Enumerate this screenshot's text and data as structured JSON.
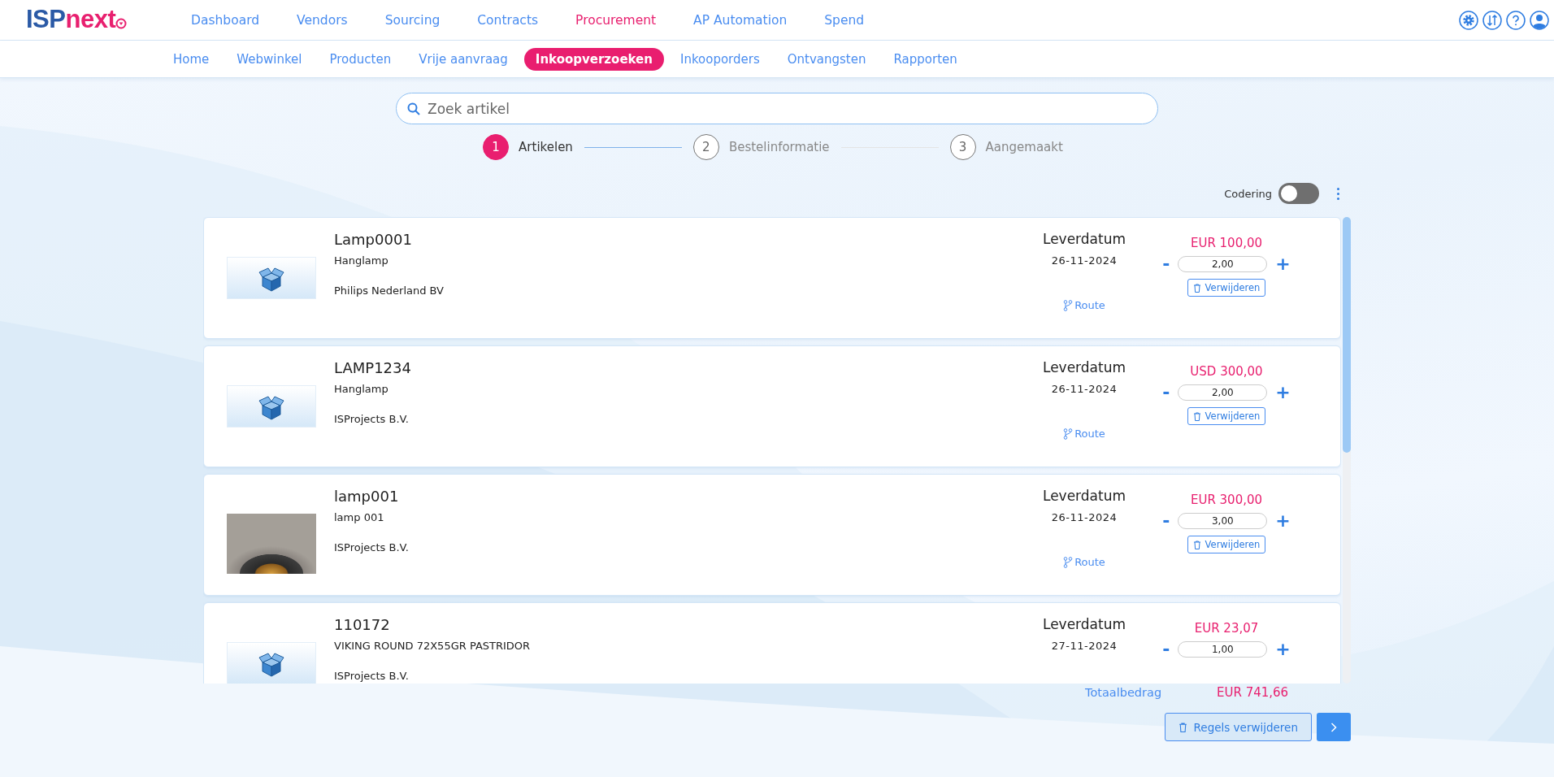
{
  "logo": {
    "text_1": "ISP",
    "text_2": "next"
  },
  "main_nav": [
    {
      "label": "Dashboard",
      "selected": false
    },
    {
      "label": "Vendors",
      "selected": false
    },
    {
      "label": "Sourcing",
      "selected": false
    },
    {
      "label": "Contracts",
      "selected": false
    },
    {
      "label": "Procurement",
      "selected": true
    },
    {
      "label": "AP Automation",
      "selected": false
    },
    {
      "label": "Spend",
      "selected": false
    }
  ],
  "sub_nav": [
    {
      "label": "Home",
      "selected": false
    },
    {
      "label": "Webwinkel",
      "selected": false
    },
    {
      "label": "Producten",
      "selected": false
    },
    {
      "label": "Vrije aanvraag",
      "selected": false
    },
    {
      "label": "Inkoopverzoeken",
      "selected": true
    },
    {
      "label": "Inkooporders",
      "selected": false
    },
    {
      "label": "Ontvangsten",
      "selected": false
    },
    {
      "label": "Rapporten",
      "selected": false
    }
  ],
  "search": {
    "placeholder": "Zoek artikel"
  },
  "steps": [
    {
      "number": "1",
      "label": "Artikelen",
      "selected": true
    },
    {
      "number": "2",
      "label": "Bestelinformatie",
      "selected": false
    },
    {
      "number": "3",
      "label": "Aangemaakt",
      "selected": false
    }
  ],
  "coding_toggle": {
    "label": "Codering",
    "on": false
  },
  "items": [
    {
      "code": "Lamp0001",
      "description": "Hanglamp",
      "supplier": "Philips Nederland BV",
      "kind": "box",
      "date_label": "Leverdatum",
      "date": "26-11-2024",
      "route": "Route",
      "price": "EUR 100,00",
      "minus": "-",
      "quantity": "2,00",
      "plus": "+",
      "delete": "Verwijderen"
    },
    {
      "code": "LAMP1234",
      "description": "Hanglamp",
      "supplier": "ISProjects B.V.",
      "kind": "box",
      "date_label": "Leverdatum",
      "date": "26-11-2024",
      "route": "Route",
      "price": "USD 300,00",
      "minus": "-",
      "quantity": "2,00",
      "plus": "+",
      "delete": "Verwijderen"
    },
    {
      "code": "lamp001",
      "description": "lamp 001",
      "supplier": "ISProjects B.V.",
      "kind": "photo",
      "date_label": "Leverdatum",
      "date": "26-11-2024",
      "route": "Route",
      "price": "EUR 300,00",
      "minus": "-",
      "quantity": "3,00",
      "plus": "+",
      "delete": "Verwijderen"
    },
    {
      "code": "110172",
      "description": "VIKING ROUND 72X55GR PASTRIDOR",
      "supplier": "ISProjects B.V.",
      "kind": "box",
      "date_label": "Leverdatum",
      "date": "27-11-2024",
      "price": "EUR 23,07",
      "minus": "-",
      "quantity": "1,00",
      "plus": "+"
    }
  ],
  "totals": {
    "label": "Totaalbedrag",
    "amount": "EUR 741,66"
  },
  "actions": {
    "delete_lines": "Regels verwijderen"
  }
}
